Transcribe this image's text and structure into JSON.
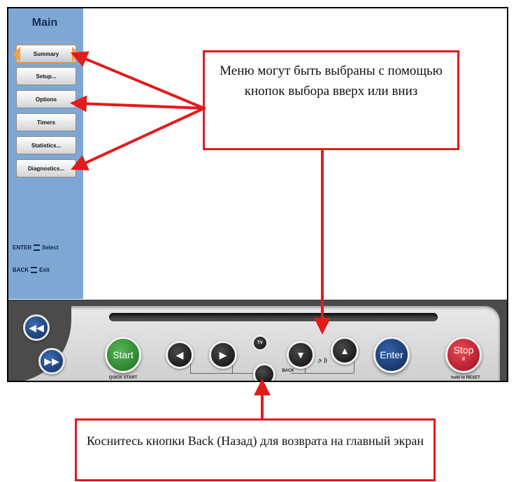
{
  "sidebar": {
    "title": "Main",
    "items": [
      {
        "label": "Summary",
        "selected": true
      },
      {
        "label": "Setup...",
        "selected": false
      },
      {
        "label": "Options",
        "selected": false
      },
      {
        "label": "Timers",
        "selected": false
      },
      {
        "label": "Statistics...",
        "selected": false
      },
      {
        "label": "Diagnostics...",
        "selected": false
      }
    ],
    "legend": {
      "enter_key": "ENTER",
      "enter_action": "Select",
      "back_key": "BACK",
      "back_action": "Exit"
    }
  },
  "console": {
    "start_label": "Start",
    "start_sublabel": "QUICK START",
    "back_label": "BACK",
    "enter_label": "Enter",
    "stop_label": "Stop",
    "stop_glyph": "II",
    "stop_sublabel": "hold to RESET",
    "tv_glyph": "TV",
    "volume_glyph": "🔈))"
  },
  "callouts": {
    "menu_hint": "Меню могут быть выбраны с помощью кнопок выбора вверх или вниз",
    "back_hint": "Коснитесь кнопки Back (Назад) для возврата на главный экран"
  },
  "colors": {
    "sidebar_bg": "#7ea7d4",
    "callout_border": "#e21b1b",
    "start_green": "#2f8a2f",
    "enter_blue": "#1d3f7a",
    "stop_red": "#c8192a"
  }
}
